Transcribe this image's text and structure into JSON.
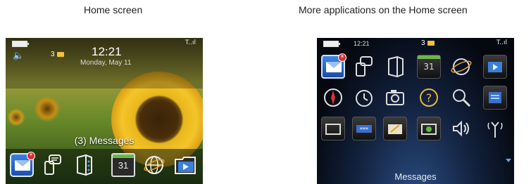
{
  "captions": {
    "left": "Home screen",
    "right": "More applications on the Home screen"
  },
  "home": {
    "status": {
      "speaker_icon": "speaker-icon",
      "notification_count": "3",
      "time": "12:21",
      "date": "Monday, May 11",
      "signal": "T..ıl"
    },
    "messages_label": "(3) Messages",
    "dock_icons": [
      "messages-icon",
      "text-messages-icon",
      "contacts-icon",
      "calendar-icon",
      "browser-icon",
      "media-icon"
    ],
    "calendar_day": "31"
  },
  "apps": {
    "status": {
      "time": "12:21",
      "notification_count": "3",
      "signal": "T..ıl"
    },
    "grid_icons": [
      "messages-icon",
      "text-messages-icon",
      "contacts-icon",
      "calendar-icon",
      "browser-icon",
      "media-icon",
      "maps-icon",
      "clock-icon",
      "camera-icon",
      "help-icon",
      "search-icon",
      "memo-icon",
      "folder-icon",
      "password-keeper-icon",
      "tasks-folder-icon",
      "settings-folder-icon",
      "sound-profile-icon",
      "wireless-icon"
    ],
    "calendar_day": "31",
    "selected_label": "Messages"
  },
  "colors": {
    "accent_blue": "#2c6ad6",
    "notification_badge": "#e02a2a",
    "envelope_yellow": "#f2c33a"
  }
}
